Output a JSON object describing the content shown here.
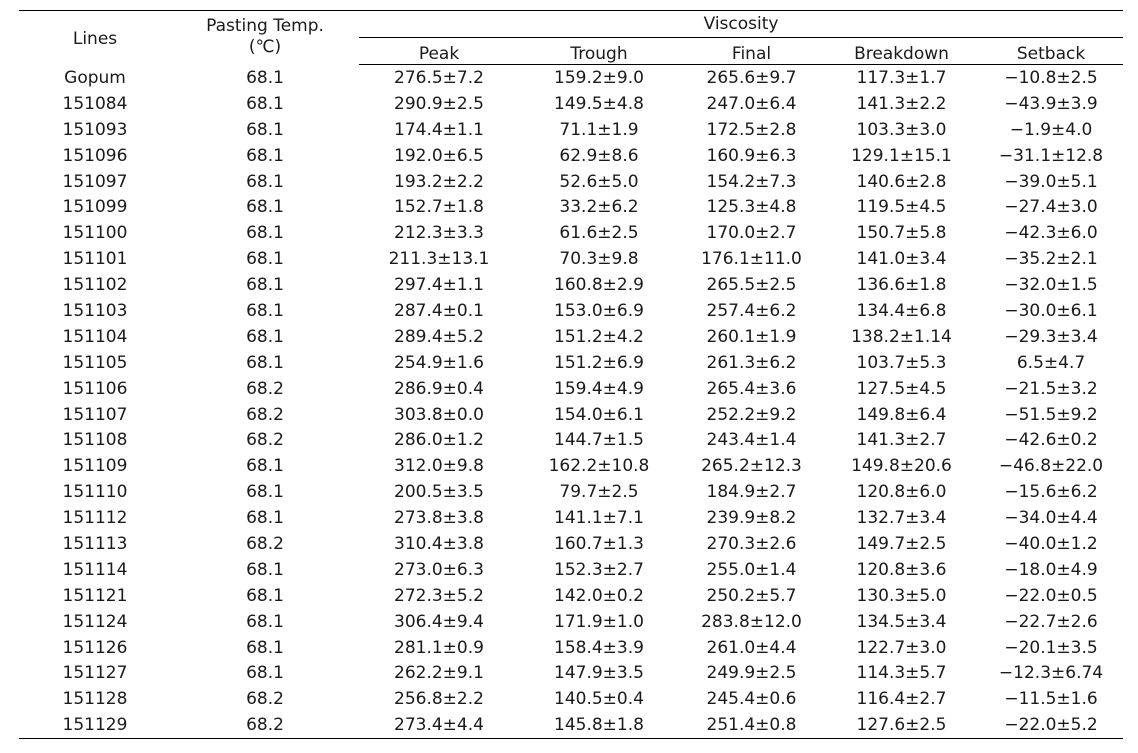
{
  "table": {
    "headers": {
      "lines": "Lines",
      "pasting_temp_line1": "Pasting Temp.",
      "pasting_temp_line2": "(℃)",
      "viscosity": "Viscosity",
      "sub": [
        "Peak",
        "Trough",
        "Final",
        "Breakdown",
        "Setback"
      ]
    },
    "rows": [
      [
        "Gopum",
        "68.1",
        "276.5±7.2",
        "159.2±9.0",
        "265.6±9.7",
        "117.3±1.7",
        "−10.8±2.5"
      ],
      [
        "151084",
        "68.1",
        "290.9±2.5",
        "149.5±4.8",
        "247.0±6.4",
        "141.3±2.2",
        "−43.9±3.9"
      ],
      [
        "151093",
        "68.1",
        "174.4±1.1",
        "71.1±1.9",
        "172.5±2.8",
        "103.3±3.0",
        "−1.9±4.0"
      ],
      [
        "151096",
        "68.1",
        "192.0±6.5",
        "62.9±8.6",
        "160.9±6.3",
        "129.1±15.1",
        "−31.1±12.8"
      ],
      [
        "151097",
        "68.1",
        "193.2±2.2",
        "52.6±5.0",
        "154.2±7.3",
        "140.6±2.8",
        "−39.0±5.1"
      ],
      [
        "151099",
        "68.1",
        "152.7±1.8",
        "33.2±6.2",
        "125.3±4.8",
        "119.5±4.5",
        "−27.4±3.0"
      ],
      [
        "151100",
        "68.1",
        "212.3±3.3",
        "61.6±2.5",
        "170.0±2.7",
        "150.7±5.8",
        "−42.3±6.0"
      ],
      [
        "151101",
        "68.1",
        "211.3±13.1",
        "70.3±9.8",
        "176.1±11.0",
        "141.0±3.4",
        "−35.2±2.1"
      ],
      [
        "151102",
        "68.1",
        "297.4±1.1",
        "160.8±2.9",
        "265.5±2.5",
        "136.6±1.8",
        "−32.0±1.5"
      ],
      [
        "151103",
        "68.1",
        "287.4±0.1",
        "153.0±6.9",
        "257.4±6.2",
        "134.4±6.8",
        "−30.0±6.1"
      ],
      [
        "151104",
        "68.1",
        "289.4±5.2",
        "151.2±4.2",
        "260.1±1.9",
        "138.2±1.14",
        "−29.3±3.4"
      ],
      [
        "151105",
        "68.1",
        "254.9±1.6",
        "151.2±6.9",
        "261.3±6.2",
        "103.7±5.3",
        "6.5±4.7"
      ],
      [
        "151106",
        "68.2",
        "286.9±0.4",
        "159.4±4.9",
        "265.4±3.6",
        "127.5±4.5",
        "−21.5±3.2"
      ],
      [
        "151107",
        "68.2",
        "303.8±0.0",
        "154.0±6.1",
        "252.2±9.2",
        "149.8±6.4",
        "−51.5±9.2"
      ],
      [
        "151108",
        "68.2",
        "286.0±1.2",
        "144.7±1.5",
        "243.4±1.4",
        "141.3±2.7",
        "−42.6±0.2"
      ],
      [
        "151109",
        "68.1",
        "312.0±9.8",
        "162.2±10.8",
        "265.2±12.3",
        "149.8±20.6",
        "−46.8±22.0"
      ],
      [
        "151110",
        "68.1",
        "200.5±3.5",
        "79.7±2.5",
        "184.9±2.7",
        "120.8±6.0",
        "−15.6±6.2"
      ],
      [
        "151112",
        "68.1",
        "273.8±3.8",
        "141.1±7.1",
        "239.9±8.2",
        "132.7±3.4",
        "−34.0±4.4"
      ],
      [
        "151113",
        "68.2",
        "310.4±3.8",
        "160.7±1.3",
        "270.3±2.6",
        "149.7±2.5",
        "−40.0±1.2"
      ],
      [
        "151114",
        "68.1",
        "273.0±6.3",
        "152.3±2.7",
        "255.0±1.4",
        "120.8±3.6",
        "−18.0±4.9"
      ],
      [
        "151121",
        "68.1",
        "272.3±5.2",
        "142.0±0.2",
        "250.2±5.7",
        "130.3±5.0",
        "−22.0±0.5"
      ],
      [
        "151124",
        "68.1",
        "306.4±9.4",
        "171.9±1.0",
        "283.8±12.0",
        "134.5±3.4",
        "−22.7±2.6"
      ],
      [
        "151126",
        "68.1",
        "281.1±0.9",
        "158.4±3.9",
        "261.0±4.4",
        "122.7±3.0",
        "−20.1±3.5"
      ],
      [
        "151127",
        "68.1",
        "262.2±9.1",
        "147.9±3.5",
        "249.9±2.5",
        "114.3±5.7",
        "−12.3±6.74"
      ],
      [
        "151128",
        "68.2",
        "256.8±2.2",
        "140.5±0.4",
        "245.4±0.6",
        "116.4±2.7",
        "−11.5±1.6"
      ],
      [
        "151129",
        "68.2",
        "273.4±4.4",
        "145.8±1.8",
        "251.4±0.8",
        "127.6±2.5",
        "−22.0±5.2"
      ]
    ]
  }
}
